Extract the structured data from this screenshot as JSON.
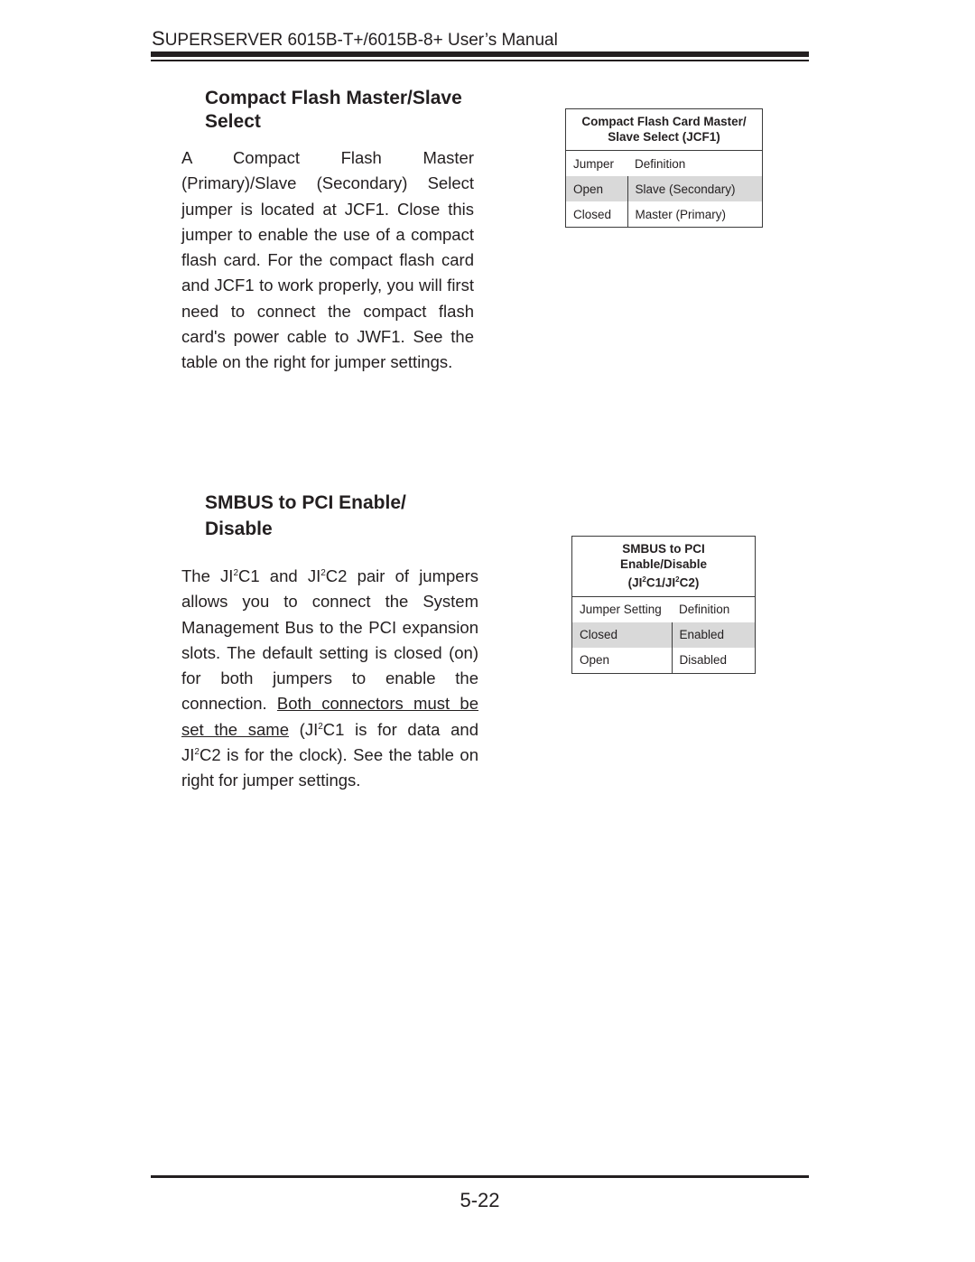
{
  "header": {
    "title_first_letter": "S",
    "title_rest": "UPERSERVER 6015B-T+/6015B-8+ User’s Manual"
  },
  "sections": [
    {
      "heading": "Compact Flash Master/Slave Select",
      "body": "A Compact Flash Master (Primary)/Slave (Secondary) Select jumper is located at JCF1.  Close this jumper to enable the use of a compact flash card.  For the compact flash card and JCF1 to work properly,  you will first need to connect the compact flash card's power cable to JWF1.  See the table on the right for jumper settings.",
      "table": {
        "caption_line1": "Compact Flash Card Master/",
        "caption_line2": "Slave Select (JCF1)",
        "headers": [
          "Jumper",
          "Definition"
        ],
        "rows": [
          {
            "setting": "Open",
            "definition": "Slave (Secondary)",
            "shaded": true
          },
          {
            "setting": "Closed",
            "definition": "Master (Primary)",
            "shaded": false
          }
        ]
      }
    },
    {
      "heading_line1": "SMBUS to PCI Enable/",
      "heading_line2": "Disable",
      "body_parts": {
        "a": "The JI",
        "sup1": "2",
        "b": "C1 and JI",
        "sup2": "2",
        "c": "C2 pair of jumpers allows you to connect the System Management Bus to the PCI expansion slots.  The default setting is closed (on) for both jumpers to enable the connection.  ",
        "underlined": "Both connectors must be set the same",
        "d": " (JI",
        "sup3": "2",
        "e": "C1 is for data and JI",
        "sup4": "2",
        "f": "C2 is for the clock).  See the table on right for jumper settings."
      },
      "table": {
        "caption_line1": "SMBUS to PCI",
        "caption_line2": "Enable/Disable",
        "caption_line3_a": "(JI",
        "caption_sup1": "2",
        "caption_line3_b": "C1/JI",
        "caption_sup2": "2",
        "caption_line3_c": "C2)",
        "headers": [
          "Jumper Setting",
          "Definition"
        ],
        "rows": [
          {
            "setting": "Closed",
            "definition": "Enabled",
            "shaded": true
          },
          {
            "setting": "Open",
            "definition": "Disabled",
            "shaded": false
          }
        ]
      }
    }
  ],
  "footer": {
    "page_number": "5-22"
  }
}
